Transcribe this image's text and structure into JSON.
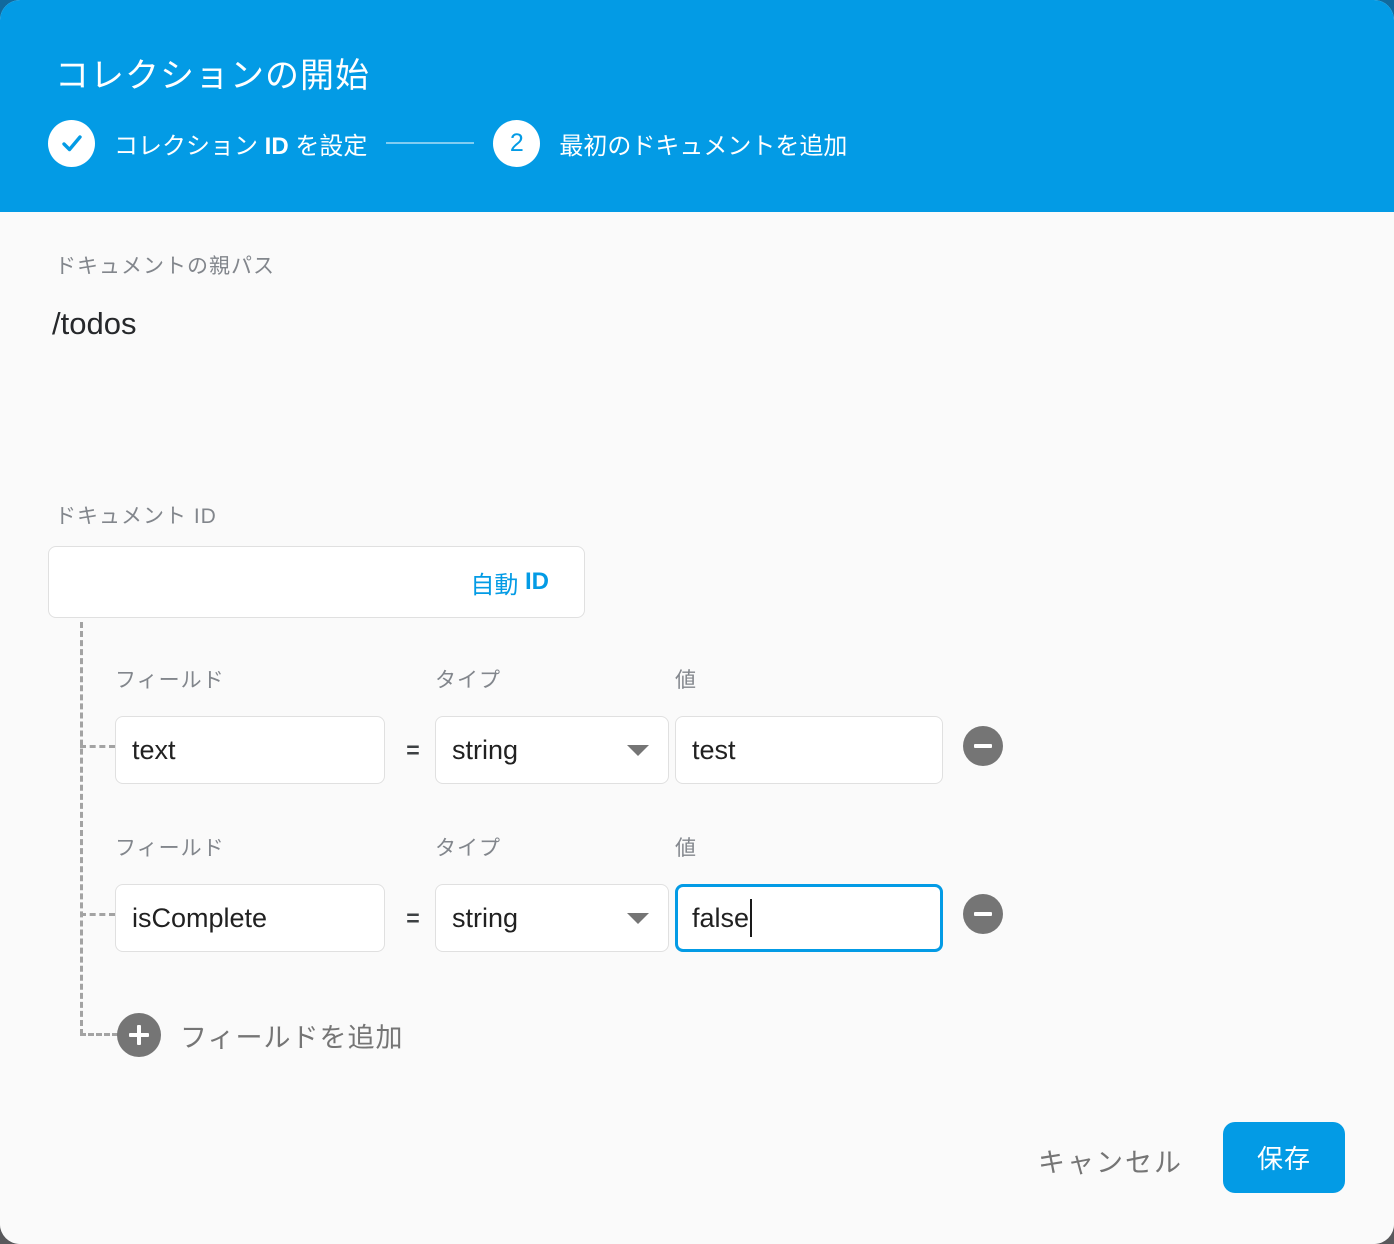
{
  "header": {
    "title": "コレクションの開始",
    "step1": {
      "text": "コレクション ",
      "bold": "ID",
      "after": " を設定"
    },
    "step2": {
      "number": "2",
      "label": "最初のドキュメントを追加"
    }
  },
  "form": {
    "parent_path": {
      "label": "ドキュメントの親パス",
      "value": "/todos"
    },
    "document_id": {
      "label": "ドキュメント ID",
      "value": "",
      "auto_id": {
        "text": "自動 ",
        "bold": "ID"
      }
    },
    "columns": {
      "field": "フィールド",
      "type": "タイプ",
      "value": "値"
    },
    "equals": "=",
    "rows": [
      {
        "field": "text",
        "type": "string",
        "value": "test"
      },
      {
        "field": "isComplete",
        "type": "string",
        "value": "false"
      }
    ],
    "add_field_label": "フィールドを追加"
  },
  "footer": {
    "cancel": "キャンセル",
    "save": "保存"
  },
  "colors": {
    "accent": "#039be5",
    "icon_grey": "#757575",
    "focus_border": "#039be5"
  }
}
